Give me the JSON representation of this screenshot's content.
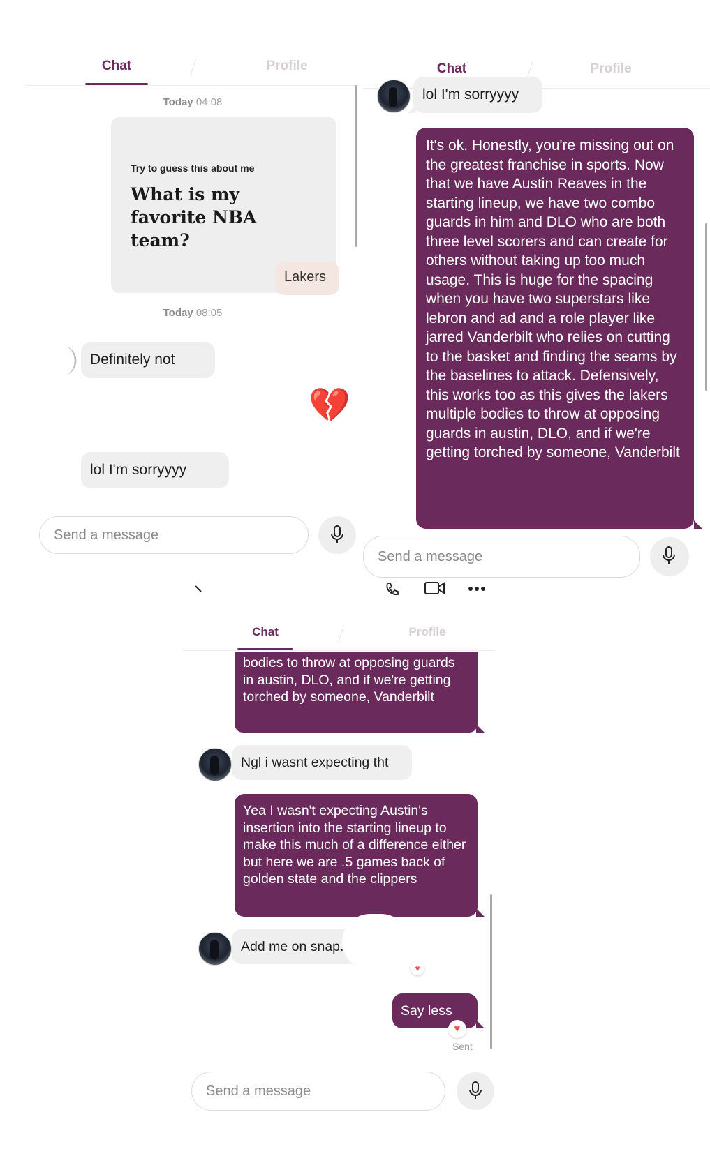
{
  "tabs": {
    "chat": "Chat",
    "profile": "Profile"
  },
  "panel1": {
    "ts1": {
      "day": "Today",
      "time": "04:08"
    },
    "prompt": {
      "label": "Try to guess this about me",
      "question": "What is my favorite NBA team?"
    },
    "answer": "Lakers",
    "ts2": {
      "day": "Today",
      "time": "08:05"
    },
    "msg_in_1": "Definitely not",
    "reaction_emoji": "💔",
    "msg_in_2": "lol I'm sorryyyy",
    "input_placeholder": "Send a message"
  },
  "panel2": {
    "msg_in": "lol I'm sorryyyy",
    "msg_out": "It's ok. Honestly, you're missing out on the greatest franchise in sports. Now that we have Austin Reaves in the starting lineup, we have two combo guards in him and DLO who are both three level scorers and can create for others without taking up too much usage. This is huge for the spacing when you have two superstars like lebron and ad and a role player like jarred Vanderbilt who relies on cutting to the basket and finding the seams by the baselines to attack. Defensively, this works too as this gives the lakers multiple bodies to throw at opposing guards in austin, DLO, and if we're getting torched by someone, Vanderbilt",
    "input_placeholder": "Send a message"
  },
  "panel3": {
    "msg_out_1": "bodies to throw at opposing guards in austin, DLO, and if we're getting torched by someone, Vanderbilt",
    "msg_in_1": "Ngl i wasnt expecting tht",
    "msg_out_2": "Yea I wasn't expecting Austin's insertion into the starting lineup to make this much of a difference either but here we are .5 games back of golden state and the clippers",
    "msg_in_2": "Add me on snap.",
    "msg_out_3": "Say less",
    "status": "Sent",
    "input_placeholder": "Send a message"
  },
  "colors": {
    "accent": "#6a2a5c",
    "incoming": "#efefef",
    "answer": "#f4e6e0"
  },
  "icons": [
    "mic-icon",
    "phone-icon",
    "video-icon",
    "more-icon",
    "heart-icon",
    "back-icon"
  ]
}
